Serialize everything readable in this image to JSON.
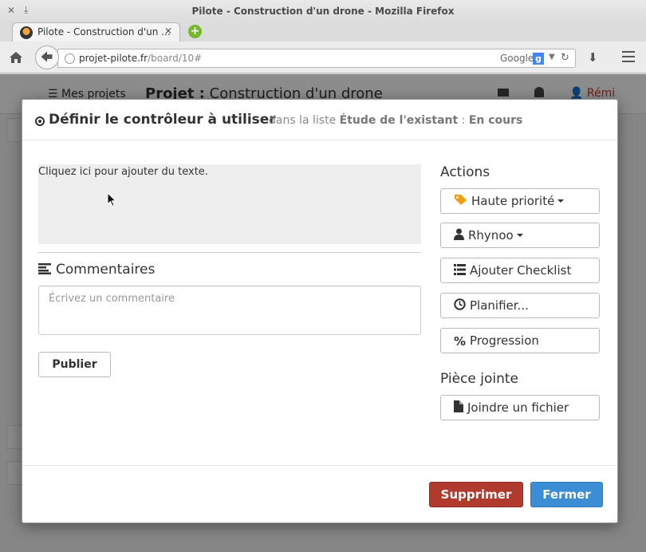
{
  "browser": {
    "window_title": "Pilote - Construction d'un drone - Mozilla Firefox",
    "tab_title": "Pilote - Construction d'un ...",
    "url_domain": "projet-pilote.fr",
    "url_path": "/board/10#",
    "search_engine": "Google"
  },
  "background_page": {
    "my_projects": "Mes projets",
    "project_label": "Projet :",
    "project_name": "Construction d'un drone",
    "user_name": "Rémi"
  },
  "card": {
    "title": "Définir le contrôleur à utiliser",
    "context_prefix": "dans la liste",
    "list_name": "Étude de l'existant",
    "context_sep": ":",
    "status": "En cours",
    "description_placeholder": "Cliquez ici pour ajouter du texte.",
    "comments_heading": "Commentaires",
    "comment_placeholder": "Écrivez un commentaire",
    "publish_label": "Publier"
  },
  "actions": {
    "heading": "Actions",
    "priority_label": "Haute priorité",
    "assignee_label": "Rhynoo",
    "checklist_label": "Ajouter Checklist",
    "schedule_label": "Planifier...",
    "progress_icon": "%",
    "progress_label": "Progression"
  },
  "attachments": {
    "heading": "Pièce jointe",
    "attach_label": "Joindre un fichier"
  },
  "footer": {
    "delete_label": "Supprimer",
    "close_label": "Fermer"
  },
  "colors": {
    "danger": "#b03a2e",
    "primary": "#3b8dd4",
    "tag_orange": "#f39c12"
  }
}
